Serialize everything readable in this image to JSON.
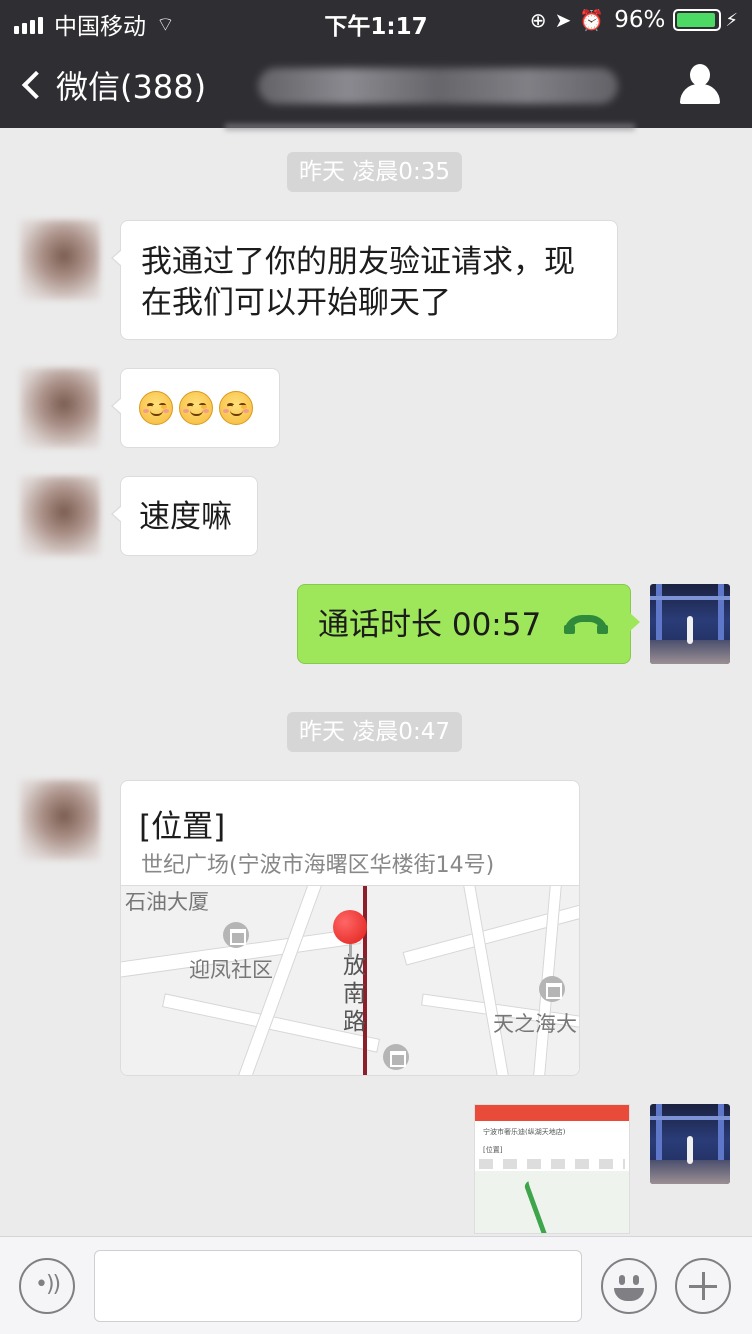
{
  "status_bar": {
    "carrier": "中国移动",
    "time": "下午1:17",
    "battery": "96%"
  },
  "nav": {
    "back_label": "微信(388)"
  },
  "timestamps": [
    "昨天 凌晨0:35",
    "昨天 凌晨0:47"
  ],
  "messages": [
    {
      "from": "contact",
      "line1": "我通过了你的朋友验证请求，现",
      "line2": "在我们可以开始聊天了"
    },
    {
      "from": "contact",
      "emoji": [
        "smiling-face",
        "smiling-face",
        "smiling-face"
      ]
    },
    {
      "from": "contact",
      "text": "速度嘛"
    },
    {
      "from": "me",
      "text": "通话时长 00:57"
    }
  ],
  "location": {
    "title": "[位置]",
    "address": "世纪广场(宁波市海曙区华楼街14号)",
    "map_labels": [
      "石油大厦",
      "迎凤社区",
      "放",
      "南",
      "路",
      "天之海大"
    ]
  },
  "screenshot_message": {
    "title": "宁波市奢乐迪(纵湖天地店)",
    "sub": "[位置]"
  },
  "input_bar": {
    "value": ""
  }
}
